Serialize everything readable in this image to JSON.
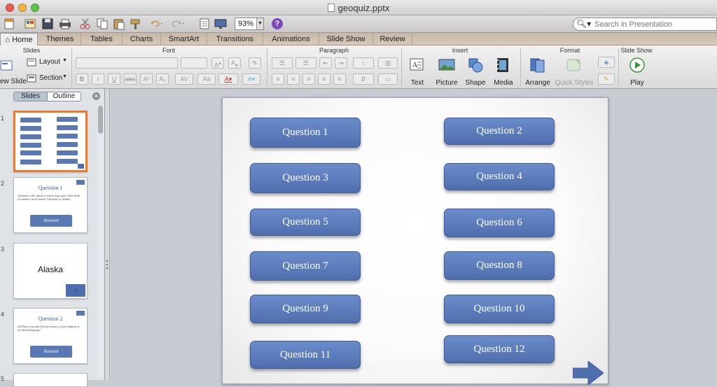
{
  "window": {
    "title": "geoquiz.pptx"
  },
  "toolbar": {
    "zoom": "93%",
    "search_placeholder": "Search in Presentation"
  },
  "ribbon_tabs": [
    "Home",
    "Themes",
    "Tables",
    "Charts",
    "SmartArt",
    "Transitions",
    "Animations",
    "Slide Show",
    "Review"
  ],
  "ribbon": {
    "groups": {
      "slides": "Slides",
      "font": "Font",
      "paragraph": "Paragraph",
      "insert": "Insert",
      "format": "Format",
      "slideshow": "Slide Show"
    },
    "new_slide": "ew Slide",
    "layout": "Layout",
    "section": "Section",
    "text": "Text",
    "picture": "Picture",
    "shape": "Shape",
    "media": "Media",
    "arrange": "Arrange",
    "quick_styles": "Quick Styles",
    "play": "Play"
  },
  "sidebar": {
    "tabs": [
      "Slides",
      "Outline"
    ],
    "slide_numbers": [
      "1",
      "2",
      "3",
      "4",
      "5"
    ],
    "thumb2": {
      "title": "Question 1",
      "body": "Q)Juneau is the capital of which large state where herds of reindeer can be found? California or Alaska?",
      "button": "Answer"
    },
    "thumb3": {
      "title": "Alaska"
    },
    "thumb4": {
      "title": "Question 2",
      "body": "Q) What is the only African country to have Spanish as an official language?",
      "button": "Answer"
    }
  },
  "slide": {
    "questions": [
      "Question 1",
      "Question 2",
      "Question 3",
      "Question 4",
      "Question 5",
      "Question 6",
      "Question 7",
      "Question 8",
      "Question 9",
      "Question 10",
      "Question 11",
      "Question 12"
    ]
  }
}
